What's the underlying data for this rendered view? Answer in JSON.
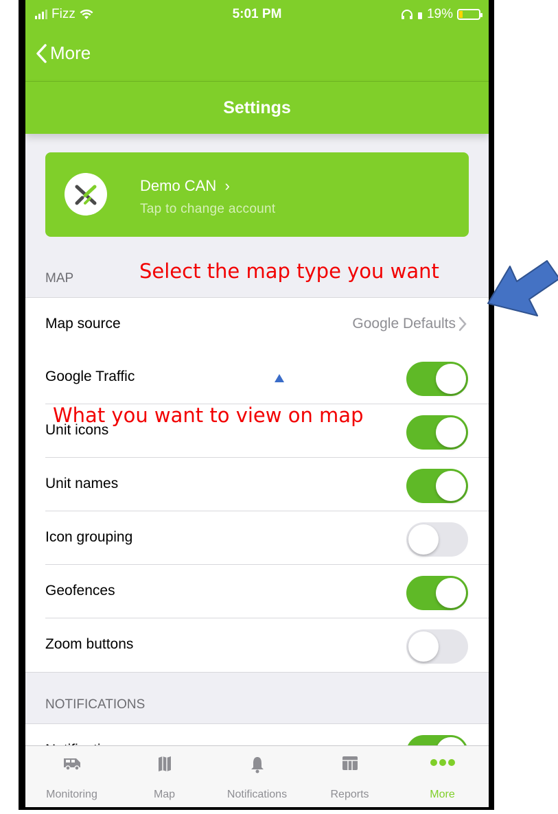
{
  "status_bar": {
    "carrier": "Fizz",
    "time": "5:01 PM",
    "battery": "19%"
  },
  "nav": {
    "back_label": "More",
    "title": "Settings"
  },
  "account": {
    "name": "Demo CAN",
    "chevron": "›",
    "subtitle": "Tap to change account"
  },
  "sections": {
    "map": "MAP",
    "notifications": "NOTIFICATIONS"
  },
  "map_rows": {
    "map_source": {
      "label": "Map source",
      "value": "Google Defaults"
    },
    "google_traffic": {
      "label": "Google Traffic",
      "on": true
    },
    "unit_icons": {
      "label": "Unit icons",
      "on": true
    },
    "unit_names": {
      "label": "Unit names",
      "on": true
    },
    "icon_grouping": {
      "label": "Icon grouping",
      "on": false
    },
    "geofences": {
      "label": "Geofences",
      "on": true
    },
    "zoom_buttons": {
      "label": "Zoom buttons",
      "on": false
    }
  },
  "notifications_rows": {
    "notifications": {
      "label": "Notifications",
      "on": true
    }
  },
  "tabs": [
    {
      "label": "Monitoring",
      "icon": "van-icon"
    },
    {
      "label": "Map",
      "icon": "map-icon"
    },
    {
      "label": "Notifications",
      "icon": "bell-icon"
    },
    {
      "label": "Reports",
      "icon": "table-icon"
    },
    {
      "label": "More",
      "icon": "more-dots-icon"
    }
  ],
  "annotations": {
    "map_type": "Select the map type you want",
    "view": "What you want to view on map"
  },
  "colors": {
    "brand_green": "#80cf2a",
    "toggle_on": "#5fb927",
    "annotation_red": "#f20000",
    "arrow_blue": "#4472c4"
  }
}
